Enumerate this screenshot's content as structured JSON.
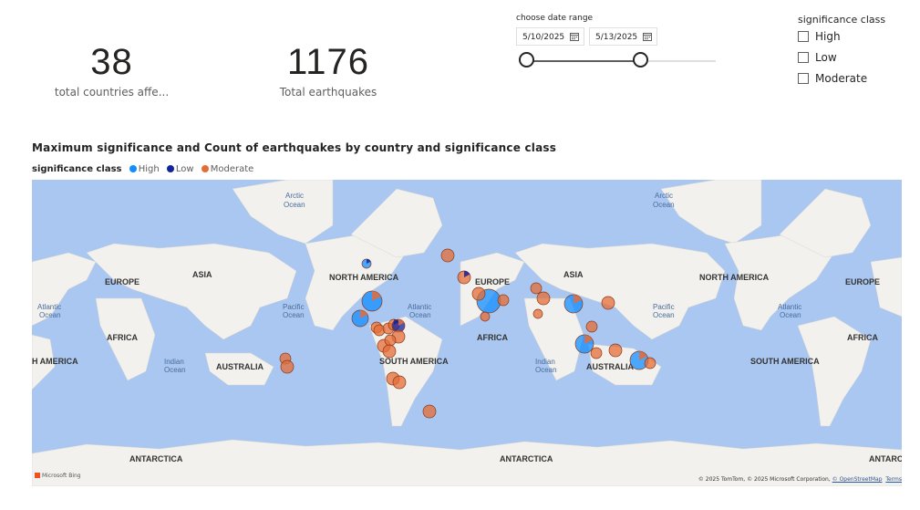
{
  "kpis": {
    "countries": {
      "value": "38",
      "label": "total countries affe..."
    },
    "earthquakes": {
      "value": "1176",
      "label": "Total earthquakes"
    }
  },
  "date_slicer": {
    "title": "choose date range",
    "start": "5/10/2025",
    "end": "5/13/2025",
    "icon": "calendar-icon"
  },
  "class_slicer": {
    "title": "significance class",
    "options": [
      {
        "label": "High",
        "checked": false
      },
      {
        "label": "Low",
        "checked": false
      },
      {
        "label": "Moderate",
        "checked": false
      }
    ]
  },
  "map": {
    "title": "Maximum significance and Count of earthquakes by country and significance class",
    "legend_title": "significance class",
    "legend": [
      {
        "label": "High",
        "color": "#118dff"
      },
      {
        "label": "Low",
        "color": "#12239e"
      },
      {
        "label": "Moderate",
        "color": "#e66c37"
      }
    ],
    "labels": {
      "arctic1": "Arctic",
      "ocean1": "Ocean",
      "arctic2": "Arctic",
      "ocean2": "Ocean",
      "europe1": "EUROPE",
      "asia1": "ASIA",
      "na1": "NORTH AMERICA",
      "europe2": "EUROPE",
      "asia2": "ASIA",
      "na2": "NORTH AMERICA",
      "europe3": "EUROPE",
      "atl1a": "Atlantic",
      "atl1b": "Ocean",
      "pac1a": "Pacific",
      "pac1b": "Ocean",
      "atl2a": "Atlantic",
      "atl2b": "Ocean",
      "pac2a": "Pacific",
      "pac2b": "Ocean",
      "atl3a": "Atlantic",
      "atl3b": "Ocean",
      "africa1": "AFRICA",
      "africa2": "AFRICA",
      "africa3": "AFRICA",
      "sa1": "H AMERICA",
      "aus1": "AUSTRALIA",
      "sa2": "SOUTH AMERICA",
      "aus2": "AUSTRALIA",
      "sa3": "SOUTH AMERICA",
      "ind1a": "Indian",
      "ind1b": "Ocean",
      "ind2a": "Indian",
      "ind2b": "Ocean",
      "ant1": "ANTARCTICA",
      "ant2": "ANTARCTICA",
      "ant3": "ANTARC"
    },
    "attribution": "© 2025 TomTom, © 2025 Microsoft Corporation,",
    "attribution_link": "© OpenStreetMap",
    "terms": "Terms",
    "bing": "Microsoft Bing"
  }
}
